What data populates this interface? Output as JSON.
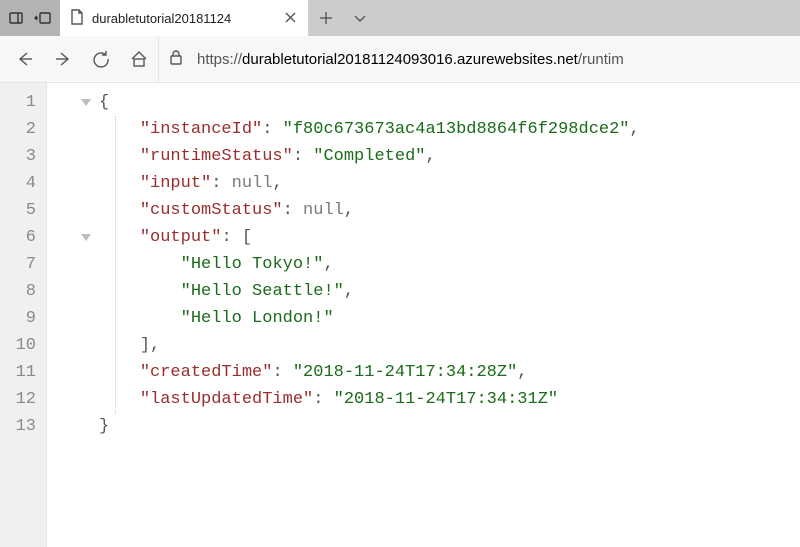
{
  "titlebar": {
    "icons": {
      "tab_aside": "tab-aside",
      "tabs_set_aside": "tabs-set-aside"
    },
    "tab": {
      "title": "durabletutorial20181124",
      "favicon": "page-icon",
      "close": "×"
    },
    "new_tab": "+",
    "down": "⌄"
  },
  "addressbar": {
    "back": "←",
    "forward": "→",
    "refresh": "⟳",
    "home": "⌂",
    "lock_icon": "lock-icon",
    "url_scheme": "https://",
    "url_host": "durabletutorial20181124093016.azurewebsites.net",
    "url_path": "/runtim"
  },
  "json_body": {
    "instanceId": "f80c673673ac4a13bd8864f6f298dce2",
    "runtimeStatus": "Completed",
    "input": null,
    "customStatus": null,
    "output": [
      "Hello Tokyo!",
      "Hello Seattle!",
      "Hello London!"
    ],
    "createdTime": "2018-11-24T17:34:28Z",
    "lastUpdatedTime": "2018-11-24T17:34:31Z"
  },
  "line_count": 13
}
